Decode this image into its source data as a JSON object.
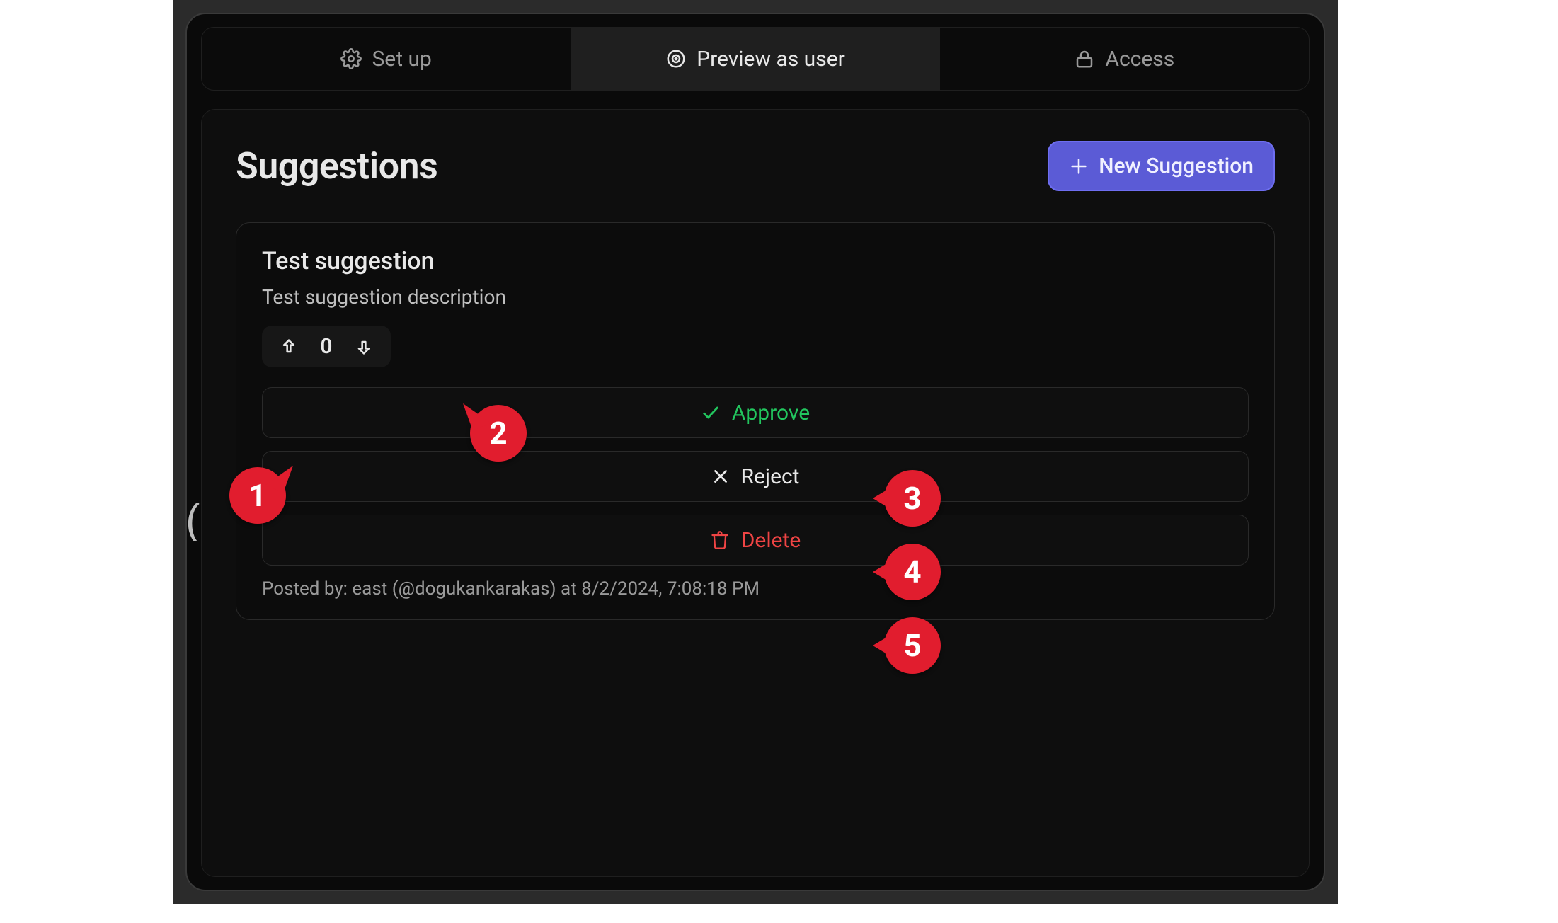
{
  "tabs": {
    "setup": {
      "label": "Set up"
    },
    "preview": {
      "label": "Preview as user"
    },
    "access": {
      "label": "Access"
    },
    "active": "preview"
  },
  "page": {
    "title": "Suggestions",
    "new_button": "New Suggestion"
  },
  "suggestion": {
    "title": "Test suggestion",
    "description": "Test suggestion description",
    "vote_count": "0",
    "actions": {
      "approve": "Approve",
      "reject": "Reject",
      "delete": "Delete"
    },
    "posted_by": "Posted by: east (@dogukankarakas) at 8/2/2024, 7:08:18 PM"
  },
  "annotations": {
    "1": "1",
    "2": "2",
    "3": "3",
    "4": "4",
    "5": "5"
  },
  "colors": {
    "primary": "#5b5bd6",
    "green": "#22c55e",
    "red": "#ef4444",
    "annotation": "#e11d2e"
  }
}
